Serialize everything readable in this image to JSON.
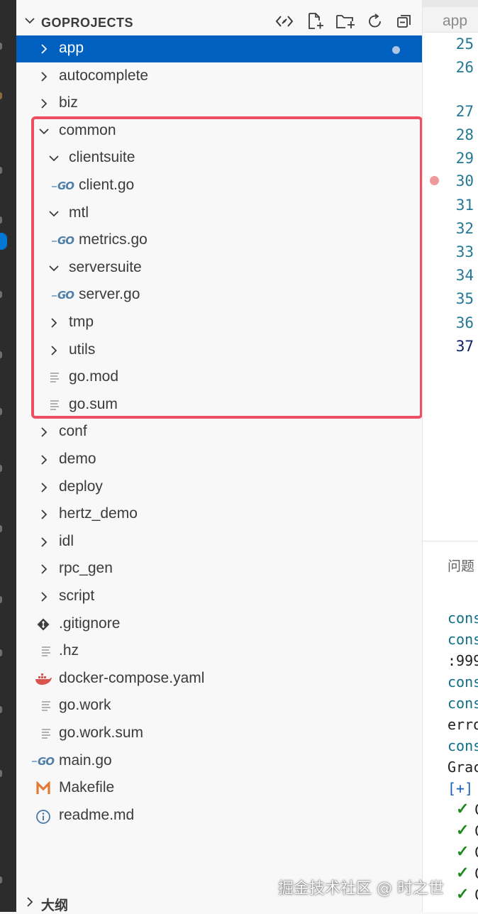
{
  "explorer": {
    "title": "GOPROJECTS",
    "tree": [
      {
        "label": "app",
        "kind": "folder",
        "expanded": false,
        "selected": true,
        "modified": true
      },
      {
        "label": "autocomplete",
        "kind": "folder",
        "expanded": false
      },
      {
        "label": "biz",
        "kind": "folder",
        "expanded": false
      },
      {
        "label": "common",
        "kind": "folder",
        "expanded": true
      },
      {
        "label": "clientsuite",
        "kind": "folder",
        "expanded": true
      },
      {
        "label": "client.go",
        "kind": "go-file"
      },
      {
        "label": "mtl",
        "kind": "folder",
        "expanded": true
      },
      {
        "label": "metrics.go",
        "kind": "go-file"
      },
      {
        "label": "serversuite",
        "kind": "folder",
        "expanded": true
      },
      {
        "label": "server.go",
        "kind": "go-file"
      },
      {
        "label": "tmp",
        "kind": "folder",
        "expanded": false
      },
      {
        "label": "utils",
        "kind": "folder",
        "expanded": false
      },
      {
        "label": "go.mod",
        "kind": "text-file"
      },
      {
        "label": "go.sum",
        "kind": "text-file"
      },
      {
        "label": "conf",
        "kind": "folder",
        "expanded": false
      },
      {
        "label": "demo",
        "kind": "folder",
        "expanded": false
      },
      {
        "label": "deploy",
        "kind": "folder",
        "expanded": false
      },
      {
        "label": "hertz_demo",
        "kind": "folder",
        "expanded": false
      },
      {
        "label": "idl",
        "kind": "folder",
        "expanded": false
      },
      {
        "label": "rpc_gen",
        "kind": "folder",
        "expanded": false
      },
      {
        "label": "script",
        "kind": "folder",
        "expanded": false
      },
      {
        "label": ".gitignore",
        "kind": "git-file"
      },
      {
        "label": ".hz",
        "kind": "text-file"
      },
      {
        "label": "docker-compose.yaml",
        "kind": "docker-file"
      },
      {
        "label": "go.work",
        "kind": "text-file"
      },
      {
        "label": "go.work.sum",
        "kind": "text-file"
      },
      {
        "label": "main.go",
        "kind": "go-file"
      },
      {
        "label": "Makefile",
        "kind": "makefile"
      },
      {
        "label": "readme.md",
        "kind": "info-file"
      }
    ],
    "outline_label": "大纲"
  },
  "editor": {
    "tab_label": "app",
    "line_numbers": [
      "25",
      "26",
      "27",
      "28",
      "29",
      "30",
      "31",
      "32",
      "33",
      "34",
      "35",
      "36",
      "37"
    ],
    "breakpoint_line": "30"
  },
  "panel": {
    "tab_label": "问题",
    "lines": [
      "cons",
      "cons",
      ":999",
      "cons",
      "cons",
      "erro",
      "cons",
      "Grac",
      "[+]"
    ],
    "check_tails": [
      "C",
      "C",
      "C",
      "C",
      "C"
    ]
  },
  "watermark": "掘金技术社区 @ 时之世",
  "colors": {
    "selection": "#0060c0",
    "highlight_border": "#ec4e62",
    "go_icon": "#4f7ea6",
    "line_number": "#237893",
    "check": "#1c8a1c"
  }
}
